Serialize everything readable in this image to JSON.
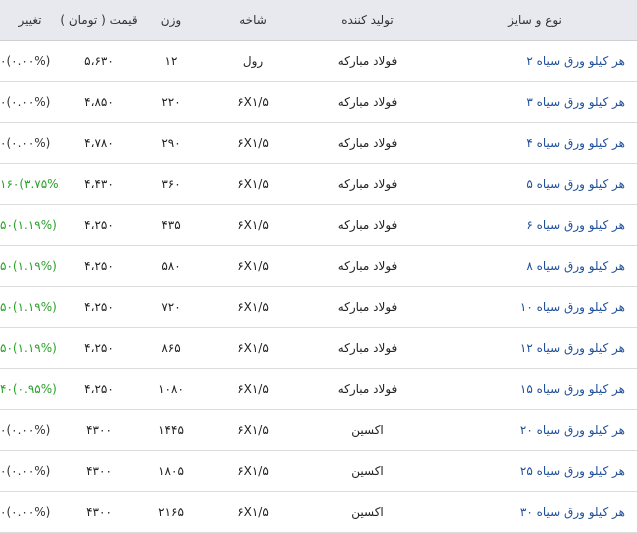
{
  "table": {
    "headers": {
      "type_size": "نوع و سایز",
      "producer": "تولید کننده",
      "branch": "شاخه",
      "weight": "وزن",
      "price": "قیمت ( تومان )",
      "change": "تغییر"
    },
    "rows": [
      {
        "type_size": "هر کیلو ورق سیاه ۲",
        "producer": "فولاد مبارکه",
        "branch": "رول",
        "weight": "۱۲",
        "price": "۵،۶۳۰",
        "change": "۰(۰.۰۰%)",
        "trend": "none"
      },
      {
        "type_size": "هر کیلو ورق سیاه ۳",
        "producer": "فولاد مبارکه",
        "branch": "۶X۱/۵",
        "weight": "۲۲۰",
        "price": "۴،۸۵۰",
        "change": "۰(۰.۰۰%)",
        "trend": "none"
      },
      {
        "type_size": "هر کیلو ورق سیاه ۴",
        "producer": "فولاد مبارکه",
        "branch": "۶X۱/۵",
        "weight": "۲۹۰",
        "price": "۴،۷۸۰",
        "change": "۰(۰.۰۰%)",
        "trend": "none"
      },
      {
        "type_size": "هر کیلو ورق سیاه ۵",
        "producer": "فولاد مبارکه",
        "branch": "۶X۱/۵",
        "weight": "۳۶۰",
        "price": "۴،۴۳۰",
        "change": "۱۶۰(۳.۷۵%)",
        "trend": "up"
      },
      {
        "type_size": "هر کیلو ورق سیاه ۶",
        "producer": "فولاد مبارکه",
        "branch": "۶X۱/۵",
        "weight": "۴۳۵",
        "price": "۴،۲۵۰",
        "change": "۵۰(۱.۱۹%)",
        "trend": "up"
      },
      {
        "type_size": "هر کیلو ورق سیاه ۸",
        "producer": "فولاد مبارکه",
        "branch": "۶X۱/۵",
        "weight": "۵۸۰",
        "price": "۴،۲۵۰",
        "change": "۵۰(۱.۱۹%)",
        "trend": "up"
      },
      {
        "type_size": "هر کیلو ورق سیاه ۱۰",
        "producer": "فولاد مبارکه",
        "branch": "۶X۱/۵",
        "weight": "۷۲۰",
        "price": "۴،۲۵۰",
        "change": "۵۰(۱.۱۹%)",
        "trend": "up"
      },
      {
        "type_size": "هر کیلو ورق سیاه ۱۲",
        "producer": "فولاد مبارکه",
        "branch": "۶X۱/۵",
        "weight": "۸۶۵",
        "price": "۴،۲۵۰",
        "change": "۵۰(۱.۱۹%)",
        "trend": "up"
      },
      {
        "type_size": "هر کیلو ورق سیاه ۱۵",
        "producer": "فولاد مبارکه",
        "branch": "۶X۱/۵",
        "weight": "۱۰۸۰",
        "price": "۴،۲۵۰",
        "change": "۴۰(۰.۹۵%)",
        "trend": "up"
      },
      {
        "type_size": "هر کیلو ورق سیاه ۲۰",
        "producer": "اکسین",
        "branch": "۶X۱/۵",
        "weight": "۱۴۴۵",
        "price": "۴۳۰۰",
        "change": "۰(۰.۰۰%)",
        "trend": "none"
      },
      {
        "type_size": "هر کیلو ورق سیاه ۲۵",
        "producer": "اکسین",
        "branch": "۶X۱/۵",
        "weight": "۱۸۰۵",
        "price": "۴۳۰۰",
        "change": "۰(۰.۰۰%)",
        "trend": "none"
      },
      {
        "type_size": "هر کیلو ورق سیاه ۳۰",
        "producer": "اکسین",
        "branch": "۶X۱/۵",
        "weight": "۲۱۶۵",
        "price": "۴۳۰۰",
        "change": "۰(۰.۰۰%)",
        "trend": "none"
      }
    ]
  },
  "colors": {
    "link": "#1f4f9a",
    "up": "#2aa12a",
    "header_bg": "#e8e9ee"
  }
}
